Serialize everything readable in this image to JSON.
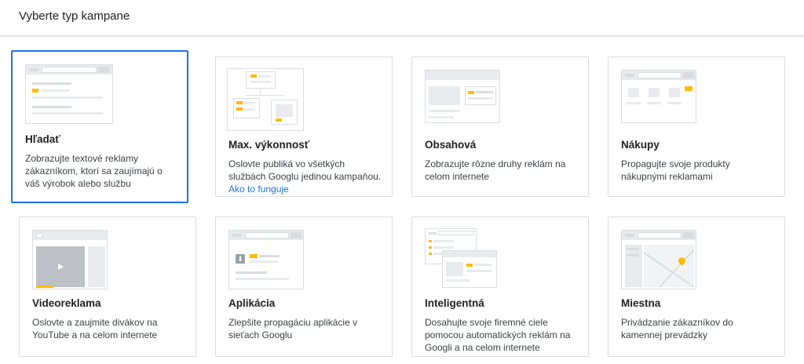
{
  "header": {
    "title": "Vyberte typ kampane"
  },
  "cards": [
    {
      "title": "Hľadať",
      "desc": "Zobrazujte textové reklamy zákazníkom, ktorí sa zaujímajú o váš výrobok alebo službu"
    },
    {
      "title": "Max. výkonnosť",
      "desc": "Oslovte publiká vo všetkých službách Googlu jedinou kampaňou.",
      "link": "Ako to funguje"
    },
    {
      "title": "Obsahová",
      "desc": "Zobrazujte rôzne druhy reklám na celom internete"
    },
    {
      "title": "Nákupy",
      "desc": "Propagujte svoje produkty nákupnými reklamami"
    },
    {
      "title": "Videoreklama",
      "desc": "Oslovte a zaujmite divákov na YouTube a na celom internete"
    },
    {
      "title": "Aplikácia",
      "desc": "Zlepšite propagáciu aplikácie v sieťach Googlu"
    },
    {
      "title": "Inteligentná",
      "desc": "Dosahujte svoje firemné ciele pomocou automatických reklám na Googli a na celom internete"
    },
    {
      "title": "Miestna",
      "desc": "Privádzanie zákazníkov do kamennej prevádzky"
    }
  ],
  "colors": {
    "accent": "#1a73e8",
    "highlight": "#fbbc04",
    "border": "#dadce0"
  }
}
